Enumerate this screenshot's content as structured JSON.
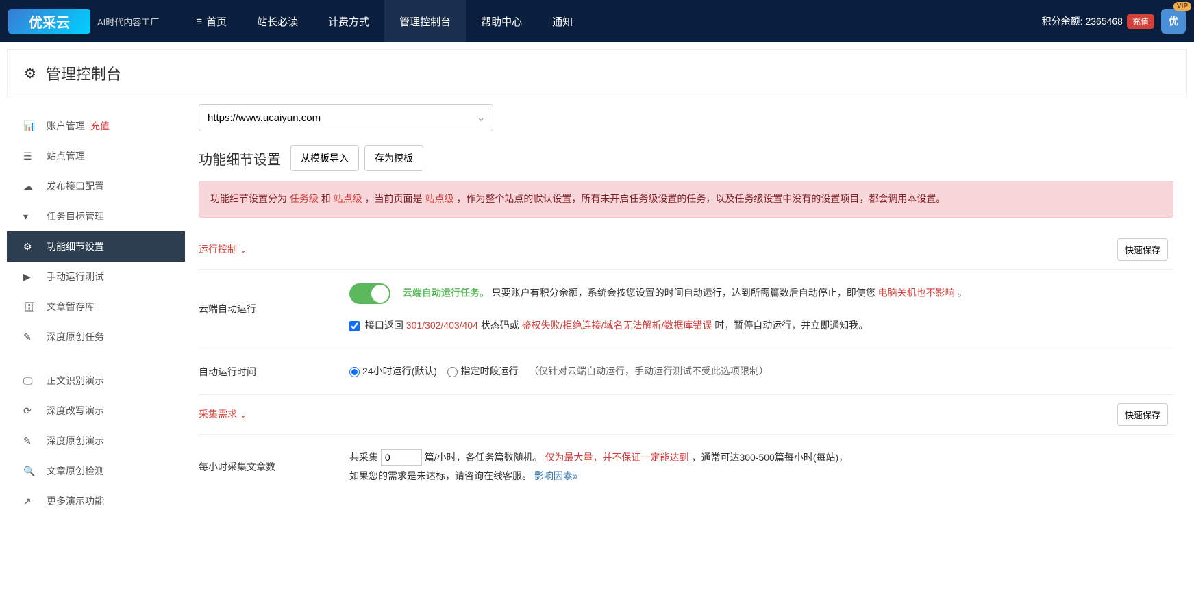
{
  "header": {
    "logo_text": "优采云",
    "logo_sub": "AI时代内容工厂",
    "nav": [
      {
        "label": "首页",
        "icon": "☰"
      },
      {
        "label": "站长必读"
      },
      {
        "label": "计费方式"
      },
      {
        "label": "管理控制台",
        "active": true
      },
      {
        "label": "帮助中心"
      },
      {
        "label": "通知"
      }
    ],
    "points_label": "积分余额:",
    "points_value": "2365468",
    "recharge": "充值",
    "avatar_text": "优",
    "vip": "VIP"
  },
  "page_title": "管理控制台",
  "sidebar": {
    "groups": [
      [
        {
          "label": "账户管理",
          "icon": "bar-chart",
          "badge": "充值"
        },
        {
          "label": "站点管理",
          "icon": "list"
        },
        {
          "label": "发布接口配置",
          "icon": "cloud"
        },
        {
          "label": "任务目标管理",
          "icon": "filter"
        },
        {
          "label": "功能细节设置",
          "icon": "cogs",
          "active": true
        },
        {
          "label": "手动运行测试",
          "icon": "play"
        },
        {
          "label": "文章暂存库",
          "icon": "database"
        },
        {
          "label": "深度原创任务",
          "icon": "edit"
        }
      ],
      [
        {
          "label": "正文识别演示",
          "icon": "monitor"
        },
        {
          "label": "深度改写演示",
          "icon": "refresh"
        },
        {
          "label": "深度原创演示",
          "icon": "edit-square"
        },
        {
          "label": "文章原创检测",
          "icon": "search"
        },
        {
          "label": "更多演示功能",
          "icon": "share"
        }
      ]
    ]
  },
  "main": {
    "site_select": "https://www.ucaiyun.com",
    "section_title": "功能细节设置",
    "btn_import": "从模板导入",
    "btn_save_tpl": "存为模板",
    "alert": {
      "p1": "功能细节设置分为",
      "tag1": "任务级",
      "p2": "和",
      "tag2": "站点级",
      "p3": "，当前页面是",
      "tag3": "站点级",
      "p4": "，作为整个站点的默认设置，所有未开启任务级设置的任务，以及任务级设置中没有的设置项目，都会调用本设置。"
    },
    "panel1": {
      "title": "运行控制",
      "quick_save": "快速保存"
    },
    "row1": {
      "label": "云端自动运行",
      "t1": "云端自动运行任务。",
      "t2": "只要账户有积分余额，系统会按您设置的时间自动运行，达到所需篇数后自动停止，即使您",
      "t3": "电脑关机也不影响",
      "t4": "。",
      "cb_t1": "接口返回",
      "cb_t2": "301/302/403/404",
      "cb_t3": "状态码或",
      "cb_t4": "鉴权失败/拒绝连接/域名无法解析/数据库错误",
      "cb_t5": "时，暂停自动运行，并立即通知我。"
    },
    "row2": {
      "label": "自动运行时间",
      "opt1": "24小时运行(默认)",
      "opt2": "指定时段运行",
      "hint": "（仅针对云端自动运行，手动运行测试不受此选项限制）"
    },
    "panel2": {
      "title": "采集需求",
      "quick_save": "快速保存"
    },
    "row3": {
      "label": "每小时采集文章数",
      "t1": "共采集",
      "input_val": "0",
      "t2": "篇/小时，各任务篇数随机。",
      "t3": "仅为最大量，并不保证一定能达到",
      "t4": "，通常可达300-500篇每小时(每站)，",
      "t5": "如果您的需求是未达标，请咨询在线客服。",
      "link": "影响因素»"
    }
  }
}
